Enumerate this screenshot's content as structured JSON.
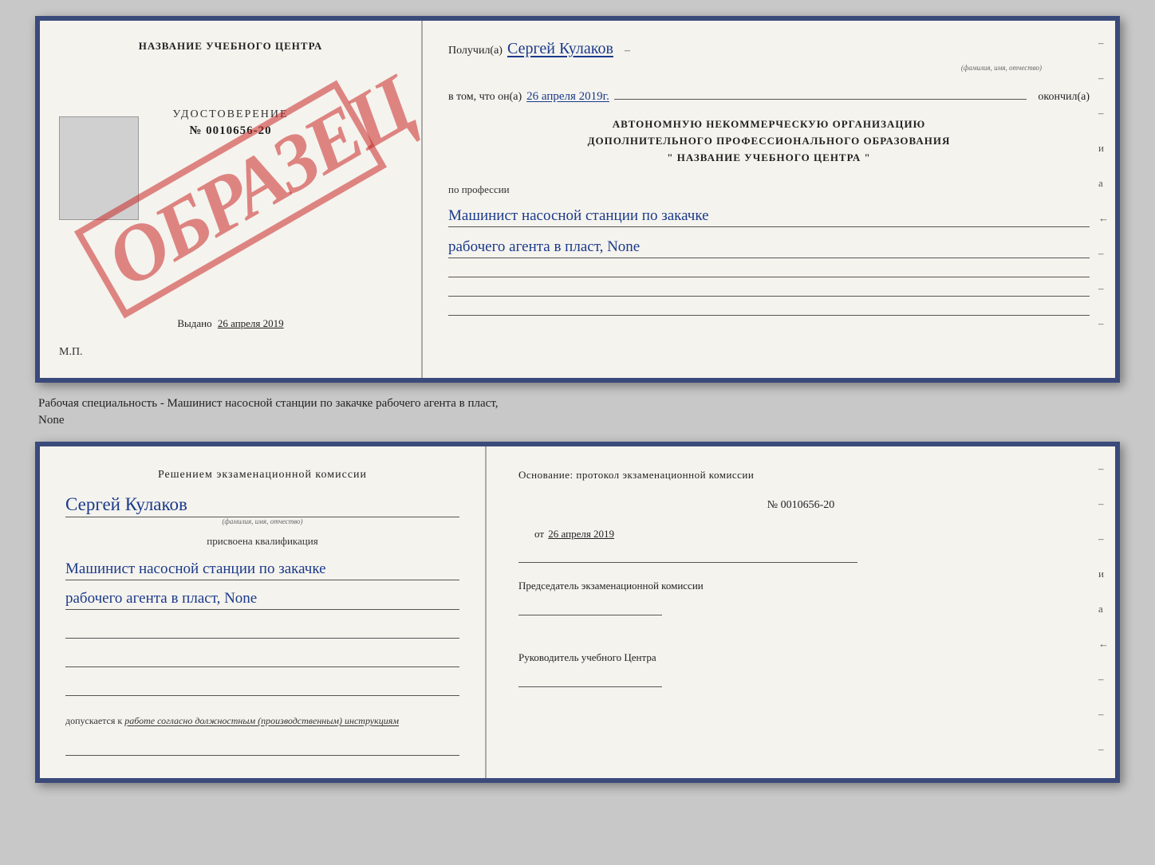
{
  "top_cert": {
    "left": {
      "training_center": "НАЗВАНИЕ УЧЕБНОГО ЦЕНТРА",
      "cert_title": "УДОСТОВЕРЕНИЕ",
      "cert_number": "№ 0010656-20",
      "issued_label": "Выдано",
      "issued_date": "26 апреля 2019",
      "mp_label": "М.П.",
      "obrazec": "ОБРАЗЕЦ"
    },
    "right": {
      "received_label": "Получил(а)",
      "received_name": "Сергей Кулаков",
      "fio_hint": "(фамилия, имя, отчество)",
      "in_that_label": "в том, что он(а)",
      "date_value": "26 апреля 2019г.",
      "finished_label": "окончил(а)",
      "org_line1": "АВТОНОМНУЮ НЕКОММЕРЧЕСКУЮ ОРГАНИЗАЦИЮ",
      "org_line2": "ДОПОЛНИТЕЛЬНОГО ПРОФЕССИОНАЛЬНОГО ОБРАЗОВАНИЯ",
      "org_line3": "\" НАЗВАНИЕ УЧЕБНОГО ЦЕНТРА \"",
      "profession_label": "по профессии",
      "profession_line1": "Машинист насосной станции по закачке",
      "profession_line2": "рабочего агента в пласт, None",
      "margin_dashes": [
        "-",
        "-",
        "-",
        "и",
        "а",
        "←",
        "-",
        "-",
        "-",
        "-"
      ]
    }
  },
  "description": {
    "text": "Рабочая специальность - Машинист насосной станции по закачке рабочего агента в пласт,",
    "text2": "None"
  },
  "bottom_cert": {
    "left": {
      "komissia_label": "Решением экзаменационной комиссии",
      "name_value": "Сергей Кулаков",
      "fio_hint": "(фамилия, имя, отчество)",
      "qualification_label": "присвоена квалификация",
      "qualification_line1": "Машинист насосной станции по закачке",
      "qualification_line2": "рабочего агента в пласт, None",
      "allowed_label": "допускается к",
      "allowed_text": "работе согласно должностным (производственным) инструкциям"
    },
    "right": {
      "osnование_label": "Основание: протокол экзаменационной комиссии",
      "protocol_number": "№ 0010656-20",
      "protocol_date_prefix": "от",
      "protocol_date": "26 апреля 2019",
      "chairman_label": "Председатель экзаменационной комиссии",
      "director_label": "Руководитель учебного Центра",
      "margin_dashes": [
        "-",
        "-",
        "-",
        "и",
        "а",
        "←",
        "-",
        "-",
        "-",
        "-"
      ]
    }
  }
}
